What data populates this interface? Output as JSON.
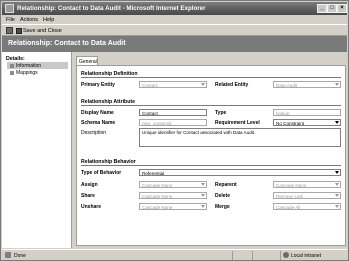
{
  "window": {
    "title": "Relationship: Contact to Data Audit - Microsoft Internet Explorer",
    "buttons": {
      "minimize": "_",
      "maximize": "□",
      "close": "×"
    }
  },
  "menu": {
    "file": "File",
    "actions": "Actions",
    "help": "Help"
  },
  "toolbar": {
    "save_and_close": "Save and Close",
    "print_icon": "print-icon",
    "save_icon": "save-close-icon"
  },
  "header": {
    "title": "Relationship: Contact to Data Audit"
  },
  "nav": {
    "heading": "Details:",
    "items": [
      {
        "label": "Information",
        "selected": true
      },
      {
        "label": "Mappings",
        "selected": false
      }
    ]
  },
  "tabs": [
    {
      "label": "General"
    }
  ],
  "definition": {
    "heading": "Relationship Definition",
    "primary_entity_label": "Primary Entity",
    "primary_entity_value": "Contact",
    "related_entity_label": "Related Entity",
    "related_entity_value": "Data Audit"
  },
  "attribute": {
    "heading": "Relationship Attribute",
    "display_name_label": "Display Name",
    "display_name_value": "Contact",
    "type_label": "Type",
    "type_value": "lookup",
    "schema_name_label": "Schema Name",
    "schema_name_value": "new_contactid",
    "requirement_label": "Requirement Level",
    "requirement_value": "No Constraint",
    "description_label": "Description",
    "description_value": "Unique identifier for Contact associated with Data Audit."
  },
  "behavior": {
    "heading": "Relationship Behavior",
    "type_label": "Type of Behavior",
    "type_value": "Referential",
    "assign_label": "Assign",
    "assign_value": "Cascade None",
    "reparent_label": "Reparent",
    "reparent_value": "Cascade None",
    "share_label": "Share",
    "share_value": "Cascade None",
    "delete_label": "Delete",
    "delete_value": "Remove Link",
    "unshare_label": "Unshare",
    "unshare_value": "Cascade None",
    "merge_label": "Merge",
    "merge_value": "Cascade All"
  },
  "status": {
    "left": "Done",
    "zone": "Local intranet"
  },
  "colors": {
    "title_bar": "#5b5b5b",
    "header_band": "#7a7a7a",
    "chrome": "#d4d0c8",
    "selected_nav": "#c8c8c8"
  }
}
